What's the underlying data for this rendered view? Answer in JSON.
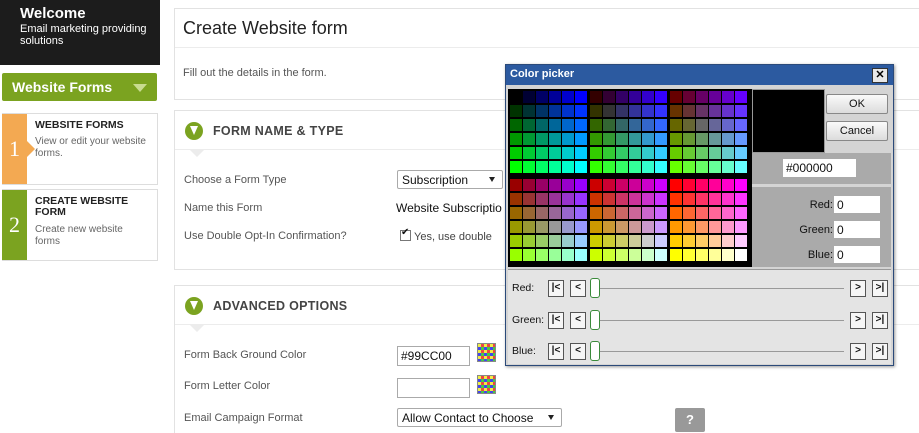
{
  "sidebar": {
    "welcome_title": "Welcome",
    "welcome_sub": "Email marketing providing solutions",
    "section": "Website Forms",
    "steps": [
      {
        "num": "1",
        "title": "WEBSITE FORMS",
        "desc": "View or edit your website forms."
      },
      {
        "num": "2",
        "title": "CREATE WEBSITE FORM",
        "desc": "Create new website forms"
      }
    ]
  },
  "header": {
    "title": "Create Website form",
    "intro": "Fill out the details in the form."
  },
  "form_name_type": {
    "title": "FORM NAME & TYPE",
    "type_label": "Choose a Form Type",
    "type_value": "Subscription",
    "name_label": "Name this Form",
    "name_value": "Website Subscriptio",
    "optin_label": "Use Double Opt-In Confirmation?",
    "optin_check": "Yes, use double"
  },
  "advanced": {
    "title": "ADVANCED OPTIONS",
    "bg_label": "Form Back Ground Color",
    "bg_value": "#99CC00",
    "letter_label": "Form Letter Color",
    "letter_value": "",
    "format_label": "Email Campaign Format",
    "format_value": "Allow Contact to Choose",
    "help": "?"
  },
  "picker": {
    "title": "Color picker",
    "close": "✕",
    "ok": "OK",
    "cancel": "Cancel",
    "hex": "#000000",
    "preview_color": "#000000",
    "red_label": "Red:",
    "green_label": "Green:",
    "blue_label": "Blue:",
    "red": "0",
    "green": "0",
    "blue": "0",
    "slider_labels": [
      "Red:",
      "Green:",
      "Blue:"
    ],
    "nav": {
      "first": "|<",
      "prev": "<",
      "next": ">",
      "last": ">|"
    }
  },
  "colors": {
    "accent_green": "#7ba320",
    "step_orange": "#f3a952",
    "titlebar": "#2c5aa0"
  }
}
